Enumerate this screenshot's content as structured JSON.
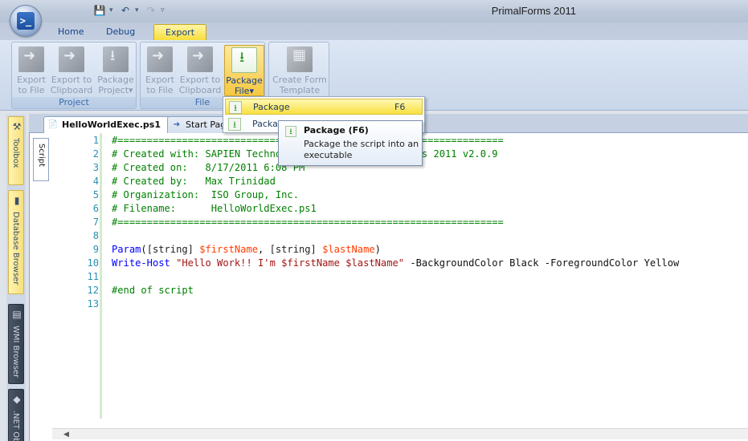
{
  "window": {
    "title": "PrimalForms 2011"
  },
  "app_menu": {
    "icon": "powershell-orb-icon",
    "glyph": ">_"
  },
  "quick_access": {
    "save_icon": "save-icon",
    "undo_icon": "undo-icon",
    "redo_icon": "redo-icon",
    "customize_icon": "customize-qat-icon"
  },
  "ribbon_tabs": [
    {
      "label": "Home"
    },
    {
      "label": "Debug"
    },
    {
      "label": "Export"
    }
  ],
  "groups": {
    "project": {
      "label": "Project",
      "buttons": [
        {
          "line1": "Export",
          "line2": "to File"
        },
        {
          "line1": "Export to",
          "line2": "Clipboard"
        },
        {
          "line1": "Package",
          "line2": "Project▾"
        }
      ]
    },
    "file": {
      "label": "File",
      "buttons": [
        {
          "line1": "Export",
          "line2": "to File"
        },
        {
          "line1": "Export to",
          "line2": "Clipboard"
        },
        {
          "line1": "Package",
          "line2": "File▾"
        }
      ]
    },
    "template": {
      "label": "",
      "buttons": [
        {
          "line1": "Create Form",
          "line2": "Template"
        }
      ]
    }
  },
  "side_panels": [
    {
      "label": "Toolbox",
      "icon": "toolbox-icon"
    },
    {
      "label": "Database Browser",
      "icon": "database-icon"
    },
    {
      "label": "WMI Browser",
      "icon": "wmi-icon"
    },
    {
      "label": ".NET Ob",
      "icon": "dotnet-icon"
    }
  ],
  "document_tabs": [
    {
      "label": "HelloWorldExec.ps1",
      "close": "×",
      "active": true
    },
    {
      "label": "Start Page",
      "active": false
    }
  ],
  "editor": {
    "view_tab": "Script",
    "lines": [
      {
        "n": "1",
        "text": "#=================================================================="
      },
      {
        "n": "2",
        "text": "# Created with: SAPIEN Technologies, Inc., PrimalForms 2011 v2.0.9"
      },
      {
        "n": "3",
        "text": "# Created on:   8/17/2011 6:08 PM"
      },
      {
        "n": "4",
        "text": "# Created by:   Max Trinidad"
      },
      {
        "n": "5",
        "text": "# Organization:  ISO Group, Inc."
      },
      {
        "n": "6",
        "text": "# Filename:      HelloWorldExec.ps1"
      },
      {
        "n": "7",
        "text": "#=================================================================="
      },
      {
        "n": "8",
        "text": ""
      },
      {
        "n": "9",
        "param": "Param",
        "open": "(",
        "t1": "[string]",
        "v1": "$firstName",
        "comma": ", ",
        "t2": "[string]",
        "v2": "$lastName",
        "close": ")"
      },
      {
        "n": "10",
        "cmd": "Write-Host",
        "str": "\"Hello Work!! I'm $firstName $lastName\"",
        "rest": " -BackgroundColor Black -ForegroundColor Yellow"
      },
      {
        "n": "11",
        "text": ""
      },
      {
        "n": "12",
        "text": "#end of script"
      },
      {
        "n": "13",
        "text": ""
      }
    ]
  },
  "package_menu": {
    "items": [
      {
        "label": "Package",
        "shortcut": "F6",
        "icon": "package-icon"
      },
      {
        "label": "Package",
        "icon": "package-add-icon"
      }
    ]
  },
  "tooltip": {
    "title": "Package (F6)",
    "body": "Package the script into an executable"
  },
  "colors": {
    "accent_tab": "#f8de3c",
    "comment": "#008000",
    "keyword": "#0000ff",
    "variable": "#ff3c00",
    "string": "#a31515",
    "line_number": "#2b91af"
  }
}
